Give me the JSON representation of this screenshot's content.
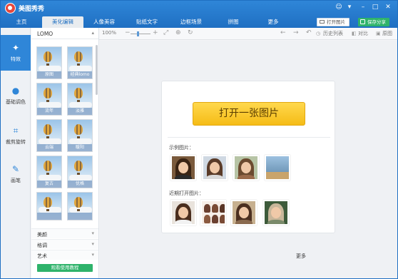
{
  "app": {
    "title": "美图秀秀"
  },
  "window_controls": [
    "☺",
    "▾",
    "–",
    "□",
    "✕"
  ],
  "tabs": [
    {
      "label": "主页"
    },
    {
      "label": "美化编辑"
    },
    {
      "label": "人像美容"
    },
    {
      "label": "贴纸文字"
    },
    {
      "label": "边框场景"
    },
    {
      "label": "拼图"
    },
    {
      "label": "更多"
    }
  ],
  "header_buttons": {
    "open": "打开图片",
    "share": "保存分享"
  },
  "toolbar": {
    "zoom": "100%",
    "history": "历史列表",
    "compare": "对比",
    "original": "原图"
  },
  "leftnav": [
    {
      "label": "特效",
      "icon": "magic-wand-icon"
    },
    {
      "label": "基础调色",
      "icon": "palette-icon"
    },
    {
      "label": "裁剪旋转",
      "icon": "crop-icon"
    },
    {
      "label": "画笔",
      "icon": "brush-icon"
    }
  ],
  "panel": {
    "category": "LOMO",
    "effects": [
      "原图",
      "经典lomo",
      "流年",
      "淡雅",
      "云端",
      "暖阳",
      "复古",
      "优格",
      "",
      ""
    ],
    "sections": [
      "美颜",
      "格调",
      "艺术"
    ],
    "tutorial": "观看使用教程"
  },
  "canvas": {
    "open_button": "打开一张图片",
    "sample_label": "示例图片：",
    "recent_label": "近期打开图片：",
    "more": "更多"
  },
  "colors": {
    "brand_blue": "#1f6fc2",
    "share_green": "#2fb36b",
    "open_yellow": "#f5bc16"
  }
}
